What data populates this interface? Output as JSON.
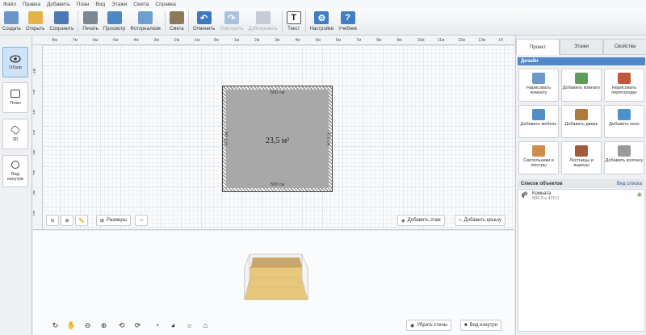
{
  "menu": [
    "Файл",
    "Правка",
    "Добавить",
    "План",
    "Вид",
    "Этажи",
    "Смета",
    "Справка"
  ],
  "toolbar": [
    {
      "label": "Создать",
      "icon": "new-file-icon",
      "color": "#6a95c8",
      "dis": false
    },
    {
      "label": "Открыть",
      "icon": "folder-icon",
      "color": "#e3b34a",
      "dis": false
    },
    {
      "label": "Сохранить",
      "icon": "save-icon",
      "color": "#4a79b4",
      "dis": false
    },
    {
      "sep": true
    },
    {
      "label": "Печать",
      "icon": "printer-icon",
      "color": "#7c8794",
      "dis": false
    },
    {
      "label": "Просмотр",
      "icon": "monitor-icon",
      "color": "#4d87c4",
      "dis": false
    },
    {
      "label": "Фотореализм",
      "icon": "photo-icon",
      "color": "#6ca0cf",
      "dis": false
    },
    {
      "sep": true
    },
    {
      "label": "Смета",
      "icon": "estimate-icon",
      "color": "#8a7a5a",
      "dis": false
    },
    {
      "sep": true
    },
    {
      "label": "Отменить",
      "icon": "undo-icon",
      "color": "#3c78c0",
      "dis": false
    },
    {
      "label": "Повторить",
      "icon": "redo-icon",
      "color": "#a8c2e0",
      "dis": true
    },
    {
      "label": "Дублировать",
      "icon": "duplicate-icon",
      "color": "#c5ccd4",
      "dis": true
    },
    {
      "sep": true
    },
    {
      "label": "Текст",
      "icon": "text-icon",
      "color": "#333",
      "dis": false
    },
    {
      "sep": true
    },
    {
      "label": "Настройки",
      "icon": "gear-icon",
      "color": "#3f7fc2",
      "dis": false
    },
    {
      "label": "Учебник",
      "icon": "help-icon",
      "color": "#3f7fc2",
      "dis": false
    }
  ],
  "left": {
    "overview": "Обзор",
    "plan": "План",
    "three_d": "3D",
    "inside": "Вид изнутри"
  },
  "ruler_top": [
    "-8м",
    "-7м",
    "-6м",
    "-5м",
    "-4м",
    "-3м",
    "-2м",
    "-1м",
    "0м",
    "1м",
    "2м",
    "3м",
    "4м",
    "5м",
    "6м",
    "7м",
    "8м",
    "9м",
    "10м",
    "11м",
    "12м",
    "13м",
    "14"
  ],
  "ruler_left": [
    "-1м",
    "0м",
    "1м",
    "2м",
    "3м",
    "4м",
    "5м",
    "6м"
  ],
  "room": {
    "top": "500 см",
    "bottom": "500 см",
    "left": "470 см",
    "right": "470 см",
    "area": "23,5 м²"
  },
  "plan_buttons": {
    "sizes": "Размеры",
    "add_floor": "Добавить этаж",
    "add_roof": "Добавить крышу"
  },
  "view3d_buttons": {
    "remove_walls": "Убрать стены",
    "inside_view": "Вид изнутри"
  },
  "tabs": [
    "Проект",
    "Этажи",
    "Свойства"
  ],
  "design": {
    "header": "Дизайн",
    "items": [
      {
        "label": "Нарисовать комнату",
        "color": "#6e98c6"
      },
      {
        "label": "Добавить комнату",
        "color": "#5e9c5a"
      },
      {
        "label": "Нарисовать перегородку",
        "color": "#c0573e"
      },
      {
        "label": "Добавить мебель",
        "color": "#4f8fc6"
      },
      {
        "label": "Добавить дверь",
        "color": "#b07a3a"
      },
      {
        "label": "Добавить окно",
        "color": "#4c92cc"
      },
      {
        "label": "Светильники и люстры",
        "color": "#d28c4a"
      },
      {
        "label": "Лестницы и вырезы",
        "color": "#a25a3a"
      },
      {
        "label": "Добавить колонну",
        "color": "#9a9a9a"
      }
    ]
  },
  "objects": {
    "header": "Список объектов",
    "view_list": "Вид списка",
    "item_name": "Комната",
    "item_size": "500.0 x 470.0"
  }
}
